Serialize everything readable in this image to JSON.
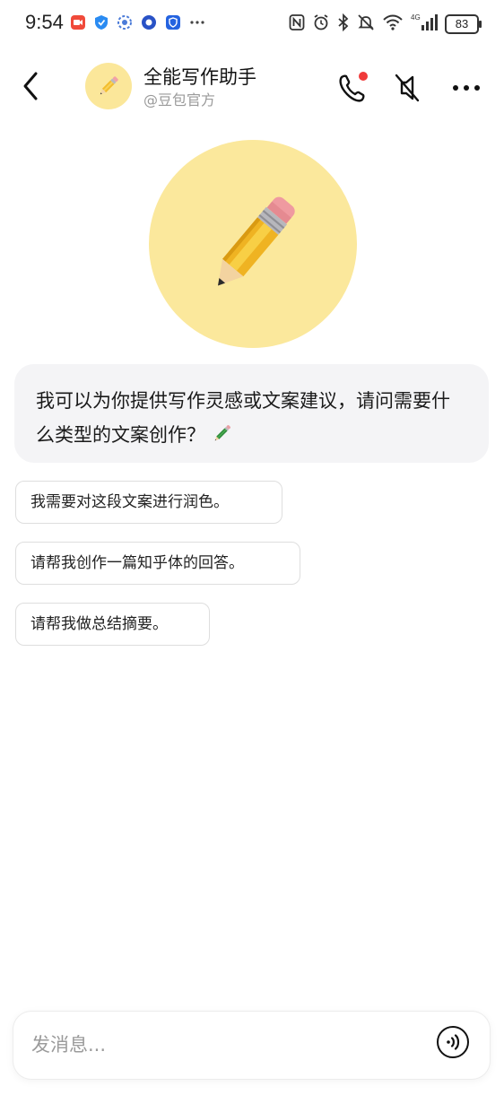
{
  "status_bar": {
    "time": "9:54",
    "battery": "83",
    "left_icons": [
      "video-app-icon",
      "shield-app-icon",
      "gear-app-icon",
      "circle-app-icon",
      "shield-outline-app-icon",
      "more-dots-icon"
    ],
    "right_icons": [
      "nfc-icon",
      "alarm-icon",
      "bluetooth-icon",
      "silent-icon",
      "wifi-icon",
      "signal-4g-icon",
      "battery-icon"
    ],
    "network_label": "4G"
  },
  "header": {
    "title": "全能写作助手",
    "subtitle": "@豆包官方",
    "icons": [
      "back-arrow-icon",
      "pencil-avatar-icon",
      "phone-call-icon",
      "speaker-mute-icon",
      "more-horizontal-icon"
    ],
    "call_badge_color": "#f03a3a"
  },
  "hero": {
    "avatar_color": "#fbe89c",
    "icon": "pencil-icon"
  },
  "greeting": {
    "text": "我可以为你提供写作灵感或文案建议，请问需要什么类型的文案创作？",
    "emoji_icon": "pencil-icon"
  },
  "suggestions": [
    {
      "label": "我需要对这段文案进行润色。"
    },
    {
      "label": "请帮我创作一篇知乎体的回答。"
    },
    {
      "label": "请帮我做总结摘要。"
    }
  ],
  "input": {
    "placeholder": "发消息...",
    "voice_icon": "voice-wave-icon"
  }
}
